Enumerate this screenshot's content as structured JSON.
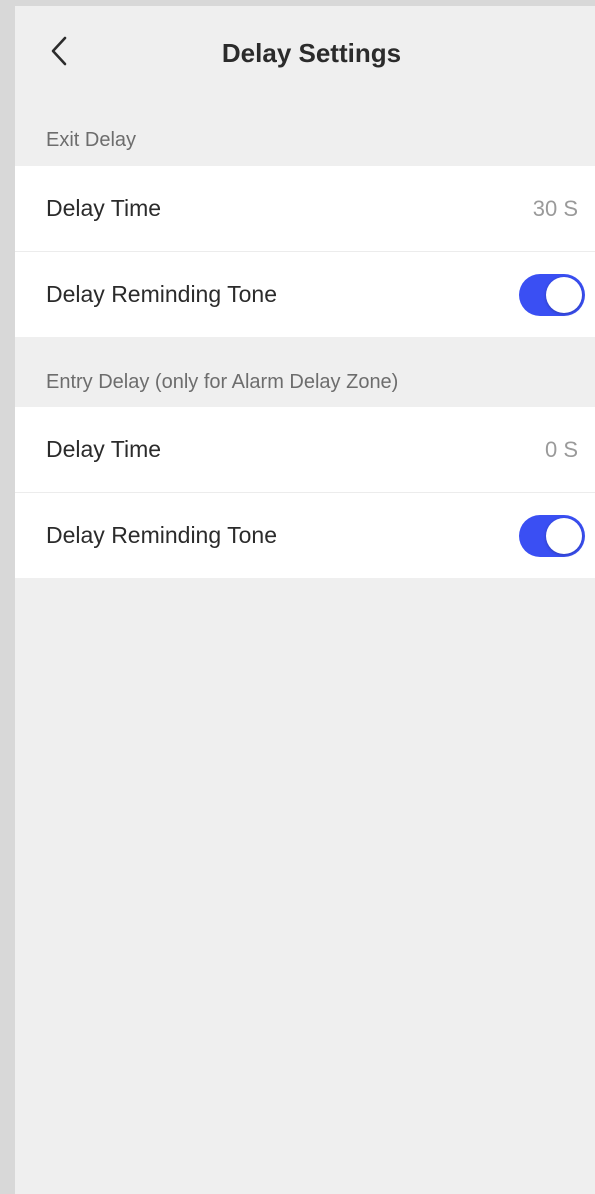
{
  "header": {
    "title": "Delay Settings",
    "back_icon": "chevron-left-icon"
  },
  "exit_delay": {
    "section_label": "Exit Delay",
    "delay_time_label": "Delay Time",
    "delay_time_value": "30 S",
    "tone_label": "Delay Reminding Tone",
    "tone_enabled": true
  },
  "entry_delay": {
    "section_label": "Entry Delay (only for Alarm Delay Zone)",
    "delay_time_label": "Delay Time",
    "delay_time_value": "0 S",
    "tone_label": "Delay Reminding Tone",
    "tone_enabled": true
  },
  "colors": {
    "accent": "#3a4ff3",
    "background": "#efefef",
    "row_background": "#ffffff"
  }
}
